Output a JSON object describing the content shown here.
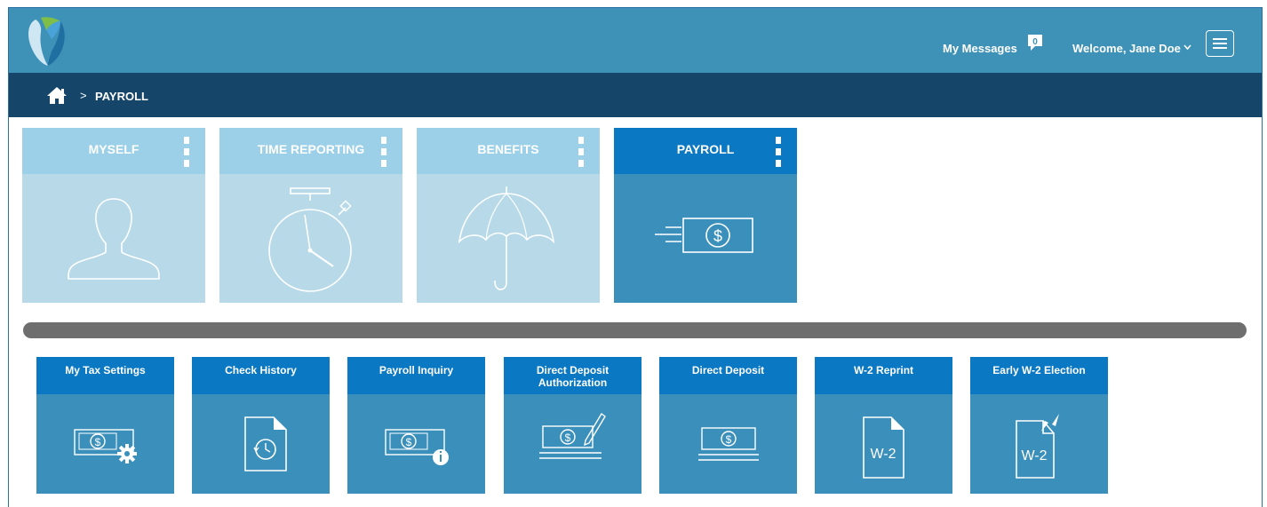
{
  "header": {
    "messages_label": "My Messages",
    "messages_count": "0",
    "welcome_label": "Welcome, Jane Doe"
  },
  "breadcrumb": {
    "separator": ">",
    "current": "PAYROLL"
  },
  "tiles": [
    {
      "label": "MYSELF",
      "icon": "person-icon"
    },
    {
      "label": "TIME REPORTING",
      "icon": "stopwatch-icon"
    },
    {
      "label": "BENEFITS",
      "icon": "umbrella-icon"
    },
    {
      "label": "PAYROLL",
      "icon": "money-icon",
      "active": true
    }
  ],
  "cards": [
    {
      "label": "My Tax Settings",
      "icon": "money-gear-icon"
    },
    {
      "label": "Check History",
      "icon": "document-history-icon"
    },
    {
      "label": "Payroll Inquiry",
      "icon": "money-info-icon"
    },
    {
      "label": "Direct Deposit Authorization",
      "icon": "money-sign-icon"
    },
    {
      "label": "Direct Deposit",
      "icon": "money-deposit-icon"
    },
    {
      "label": "W-2 Reprint",
      "icon": "w2-document-icon",
      "doc_text": "W-2"
    },
    {
      "label": "Early W-2 Election",
      "icon": "w2-early-icon",
      "doc_text": "W-2"
    }
  ],
  "colors": {
    "topbar": "#3e92b8",
    "breadcrumb_bar": "#16456a",
    "tile_header_light": "#9cd0e8",
    "tile_body_light": "#b7d9e8",
    "active_header": "#0a78c2",
    "active_body": "#3b8fbb",
    "divider": "#6e6e6e"
  }
}
